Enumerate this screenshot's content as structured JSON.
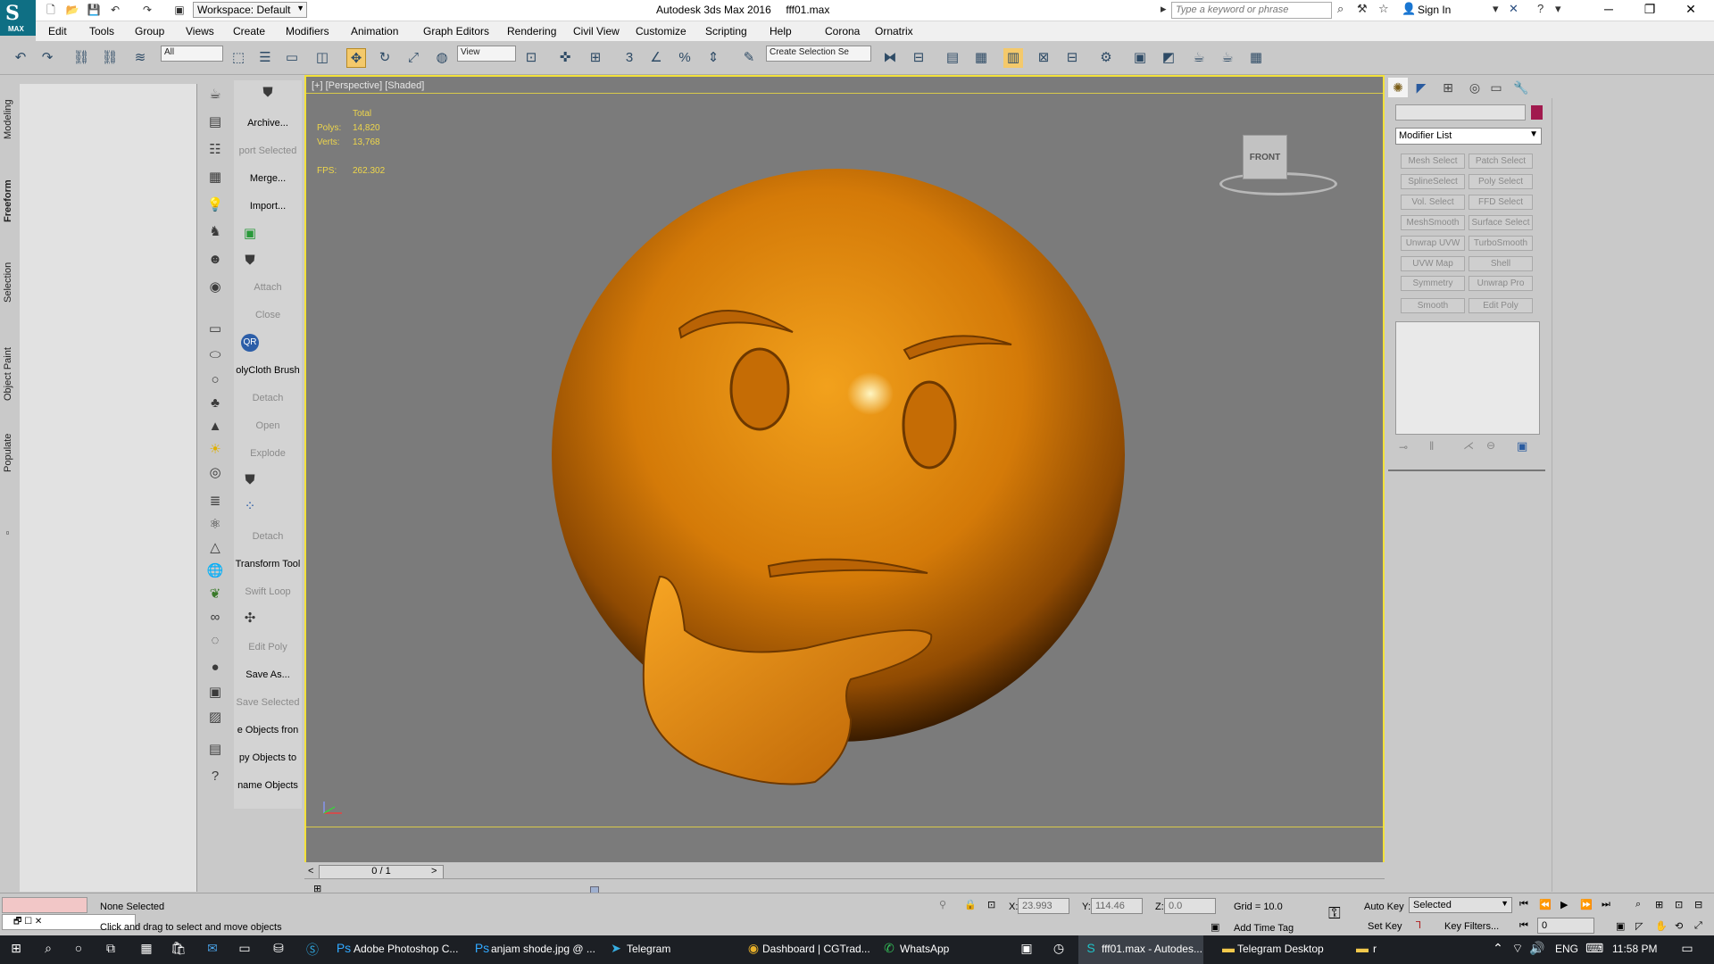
{
  "window": {
    "title": "Autodesk 3ds Max 2016",
    "file": "fff01.max",
    "workspace": "Workspace: Default",
    "search_placeholder": "Type a keyword or phrase",
    "signin": "Sign In",
    "logo_label": "MAX"
  },
  "menu": [
    "Edit",
    "Tools",
    "Group",
    "Views",
    "Create",
    "Modifiers",
    "Animation",
    "Graph Editors",
    "Rendering",
    "Civil View",
    "Customize",
    "Scripting",
    "Help",
    "Corona",
    "Ornatrix"
  ],
  "toolbar": {
    "filter": "All",
    "coord_system": "View",
    "selection_set": "Create Selection Se"
  },
  "left_tabs": [
    "Modeling",
    "Freeform",
    "Selection",
    "Object Paint",
    "Populate"
  ],
  "panel_list": [
    {
      "label": "Archive...",
      "dis": false
    },
    {
      "label": "port Selected",
      "dis": true
    },
    {
      "label": "Merge...",
      "dis": false
    },
    {
      "label": "Import...",
      "dis": false
    },
    {
      "label": "Attach",
      "dis": true
    },
    {
      "label": "Close",
      "dis": true
    },
    {
      "label": "olyCloth Brush",
      "dis": false
    },
    {
      "label": "Detach",
      "dis": true
    },
    {
      "label": "Open",
      "dis": true
    },
    {
      "label": "Explode",
      "dis": true
    },
    {
      "label": "Detach",
      "dis": true
    },
    {
      "label": "Transform Tool",
      "dis": false
    },
    {
      "label": "Swift Loop",
      "dis": true
    },
    {
      "label": "Edit Poly",
      "dis": true
    },
    {
      "label": "Save As...",
      "dis": false
    },
    {
      "label": "Save Selected",
      "dis": true
    },
    {
      "label": "e Objects fron",
      "dis": false
    },
    {
      "label": "py Objects to",
      "dis": false
    },
    {
      "label": "name Objects",
      "dis": false
    }
  ],
  "viewport": {
    "label": "[+] [Perspective] [Shaded]",
    "total_label": "Total",
    "polys_label": "Polys:",
    "polys": "14,820",
    "verts_label": "Verts:",
    "verts": "13,768",
    "fps_label": "FPS:",
    "fps": "262.302",
    "viewcube": "FRONT"
  },
  "timeline": {
    "frame": "0 / 1"
  },
  "command_panel": {
    "modifier_list": "Modifier List",
    "buttons": [
      "Mesh Select",
      "Patch Select",
      "SplineSelect",
      "Poly Select",
      "Vol. Select",
      "FFD Select",
      "MeshSmooth",
      "Surface Select",
      "Unwrap UVW",
      "TurboSmooth",
      "UVW Map",
      "Shell",
      "Symmetry",
      "Unwrap Pro",
      "Smooth",
      "Edit Poly"
    ],
    "object_color": "#a11a4e"
  },
  "status": {
    "selection": "None Selected",
    "prompt": "Click and drag to select and move objects",
    "x_label": "X:",
    "x": "23.993",
    "y_label": "Y:",
    "y": "114.46",
    "z_label": "Z:",
    "z": "0.0",
    "grid": "Grid = 10.0",
    "add_time_tag": "Add Time Tag",
    "auto_key": "Auto Key",
    "set_key": "Set Key",
    "key_mode": "Selected",
    "key_filters": "Key Filters...",
    "frame_value": "0"
  },
  "taskbar": {
    "apps": [
      "Adobe Photoshop C...",
      "anjam shode.jpg @ ...",
      "Telegram",
      "Dashboard | CGTrad...",
      "WhatsApp",
      "fff01.max - Autodes...",
      "Telegram Desktop",
      "r"
    ],
    "lang": "ENG",
    "time": "11:58 PM"
  }
}
